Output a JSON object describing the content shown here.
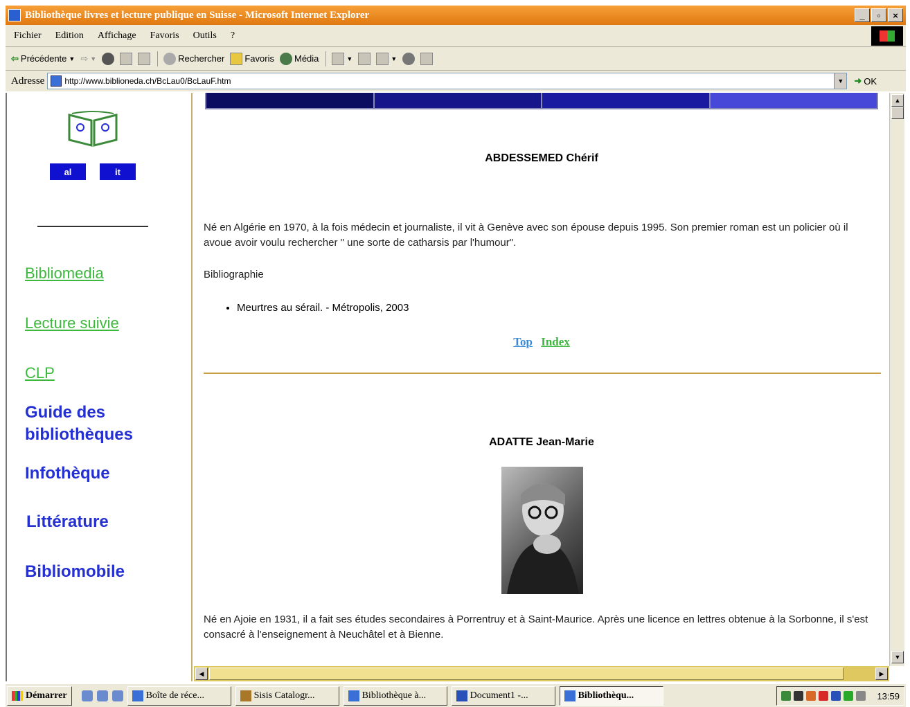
{
  "window": {
    "title": "Bibliothèque livres et lecture publique en Suisse - Microsoft Internet Explorer",
    "controls": [
      "_",
      "▫",
      "×"
    ]
  },
  "menu": [
    "Fichier",
    "Edition",
    "Affichage",
    "Favoris",
    "Outils",
    "?"
  ],
  "toolbar": {
    "back": "Précédente",
    "search": "Rechercher",
    "favorites": "Favoris",
    "media": "Média"
  },
  "address": {
    "label": "Adresse",
    "url": "http://www.biblioneda.ch/BcLau0/BcLauF.htm",
    "go": "OK"
  },
  "left": {
    "lang": [
      "al",
      "it"
    ],
    "links": [
      "Bibliomedia",
      "Lecture suivie",
      "CLP"
    ],
    "main": [
      "Guide des bibliothèques",
      "Infothèque",
      "Littérature",
      "Bibliomobile"
    ],
    "colors": {
      "link": "#3cb83c",
      "main": "#2430d0",
      "lang_btn": "#1010d0"
    }
  },
  "content": {
    "author1": {
      "name": "ABDESSEMED Chérif",
      "bio": "Né en Algérie en 1970, à la fois médecin et journaliste, il vit à Genève avec son épouse depuis 1995. Son premier roman est un policier où il avoue avoir voulu rechercher \" une sorte de catharsis par l'humour\".",
      "biblio_label": "Bibliographie",
      "books": [
        "Meurtres au sérail. - Métropolis, 2003"
      ]
    },
    "nav": {
      "top": "Top",
      "index": "Index"
    },
    "author2": {
      "name": "ADATTE Jean-Marie",
      "bio": "Né en Ajoie en 1931, il a fait ses études secondaires à Porrentruy et à Saint-Maurice. Après une licence en lettres obtenue à la Sorbonne, il s'est consacré à l'enseignement à Neuchâtel et à Bienne."
    }
  },
  "taskbar": {
    "start": "Démarrer",
    "tasks": [
      "Boîte de réce...",
      "Sisis Catalogr...",
      "Bibliothèque à...",
      "Document1 -...",
      "Bibliothèqu..."
    ],
    "active_index": 4,
    "clock": "13:59"
  }
}
